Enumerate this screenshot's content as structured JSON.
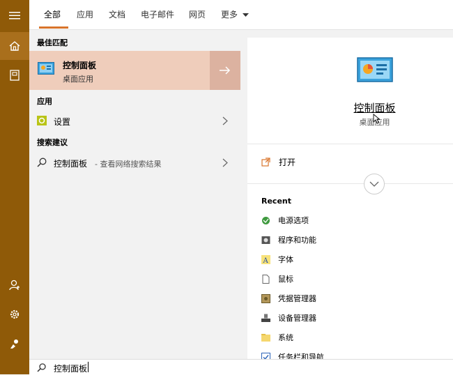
{
  "tabs": [
    {
      "label": "全部"
    },
    {
      "label": "应用"
    },
    {
      "label": "文档"
    },
    {
      "label": "电子邮件"
    },
    {
      "label": "网页"
    },
    {
      "label": "更多"
    }
  ],
  "left": {
    "best_match_heading": "最佳匹配",
    "best_match": {
      "title": "控制面板",
      "subtitle": "桌面应用"
    },
    "apps_heading": "应用",
    "apps": [
      {
        "label": "设置"
      }
    ],
    "suggestions_heading": "搜索建议",
    "suggestion": {
      "query": "控制面板",
      "hint": "- 查看网络搜索结果"
    }
  },
  "detail": {
    "title": "控制面板",
    "subtitle": "桌面应用",
    "open_label": "打开",
    "recent_heading": "Recent",
    "recent": [
      {
        "label": "电源选项",
        "icon": "power-options-icon"
      },
      {
        "label": "程序和功能",
        "icon": "programs-features-icon"
      },
      {
        "label": "字体",
        "icon": "fonts-icon"
      },
      {
        "label": "鼠标",
        "icon": "mouse-icon"
      },
      {
        "label": "凭据管理器",
        "icon": "credential-manager-icon"
      },
      {
        "label": "设备管理器",
        "icon": "device-manager-icon"
      },
      {
        "label": "系统",
        "icon": "system-folder-icon"
      },
      {
        "label": "任务栏和导航",
        "icon": "taskbar-icon"
      }
    ]
  },
  "search": {
    "value": "控制面板"
  },
  "colors": {
    "rail": "#8f5a08",
    "accent": "#d9742b",
    "best_match_bg": "#efcdbb"
  }
}
